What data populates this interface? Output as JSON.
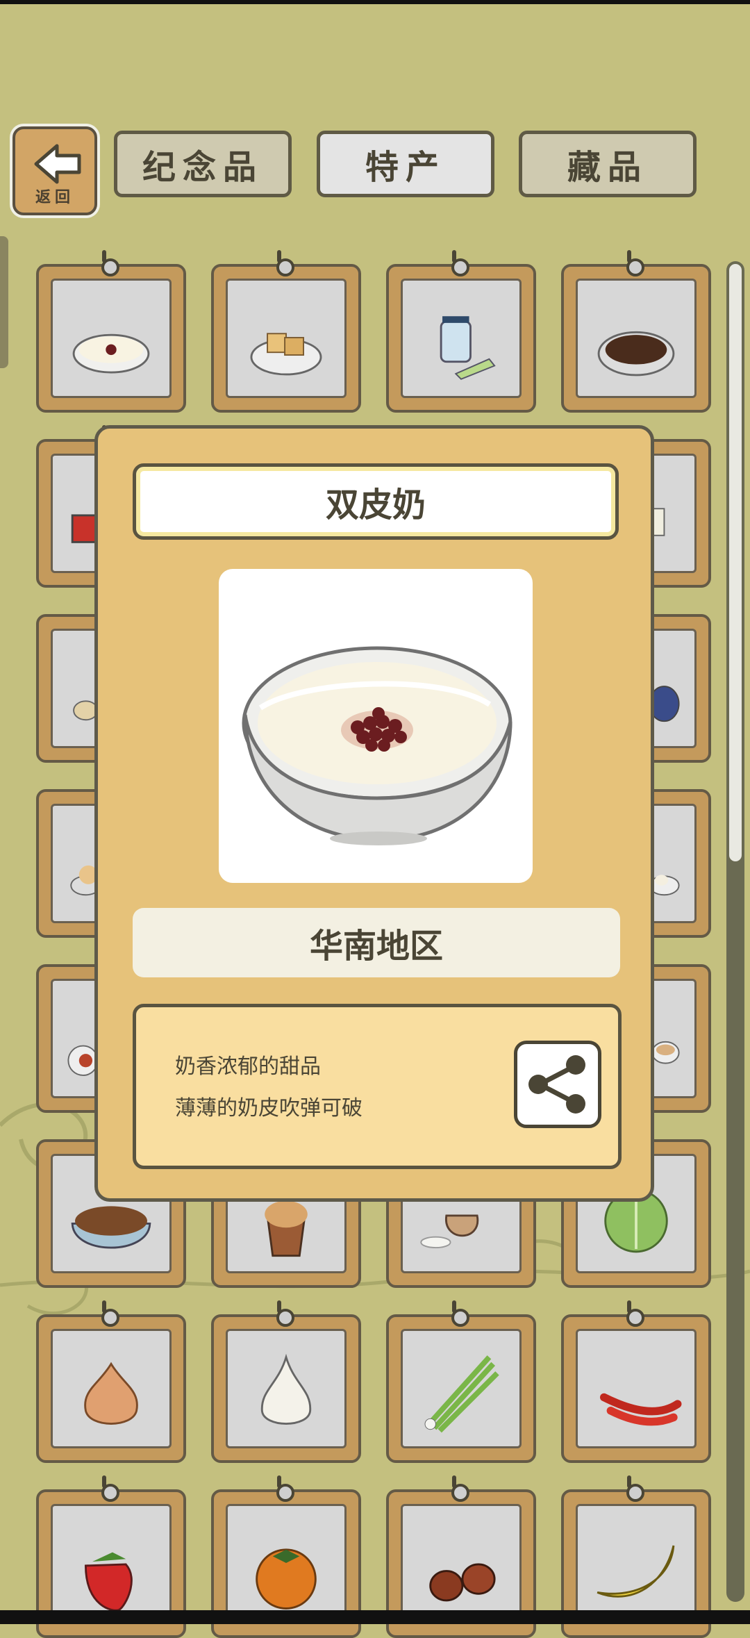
{
  "header": {
    "back_label": "返回",
    "tabs": [
      {
        "label": "纪念品",
        "active": false
      },
      {
        "label": "特产",
        "active": true
      },
      {
        "label": "藏品",
        "active": false
      }
    ]
  },
  "grid_items": [
    "double-skin-milk-icon",
    "tofu-icon",
    "jar-and-tea-icon",
    "coffee-beans-icon",
    "red-box-icon",
    "blank-icon",
    "blank-icon",
    "cake-icon",
    "ginger-icon",
    "blank-icon",
    "blank-icon",
    "blue-plate-icon",
    "bread-plate-icon",
    "blank-icon",
    "blank-icon",
    "dumpling-plate-icon",
    "noodle-bowl-icon",
    "blank-icon",
    "blank-icon",
    "soup-bowl-icon",
    "nuts-bowl-icon",
    "peanuts-icon",
    "rice-sack-icon",
    "cabbage-icon",
    "onion-icon",
    "garlic-icon",
    "scallion-icon",
    "chili-icon",
    "strawberry-icon",
    "persimmon-icon",
    "chestnut-icon",
    "banana-icon"
  ],
  "dialog": {
    "item_name": "双皮奶",
    "item_icon": "double-skin-milk-icon",
    "region": "华南地区",
    "description": [
      "奶香浓郁的甜品",
      "薄薄的奶皮吹弹可破"
    ],
    "share_icon": "share-icon"
  },
  "colors": {
    "background": "#c4c07f",
    "dialog": "#e6c27a",
    "card_frame": "#c49a5c",
    "text": "#4a4535"
  }
}
